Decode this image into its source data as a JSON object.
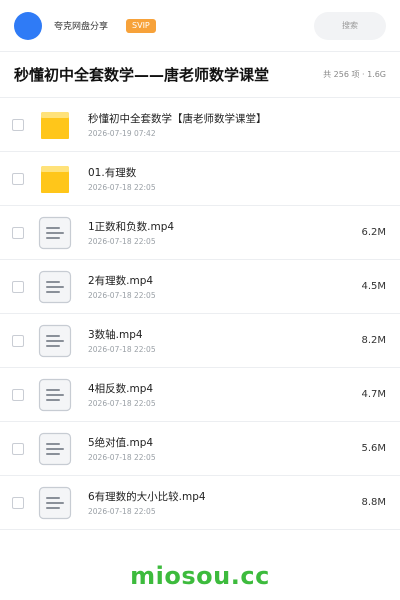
{
  "header": {
    "username": "夸克网盘分享",
    "badge": "SVIP",
    "search_placeholder": "搜索"
  },
  "folder": {
    "title": "秒懂初中全套数学——唐老师数学课堂",
    "meta": "共 256 项 · 1.6G"
  },
  "files": [
    {
      "name": "秒懂初中全套数学【唐老师数学课堂】",
      "date": "2026-07-19 07:42",
      "size": "",
      "icon": "folder-icon"
    },
    {
      "name": "01.有理数",
      "date": "2026-07-18 22:05",
      "size": "",
      "icon": "folder-icon"
    },
    {
      "name": "1正数和负数.mp4",
      "date": "2026-07-18 22:05",
      "size": "6.2M",
      "icon": "file-icon"
    },
    {
      "name": "2有理数.mp4",
      "date": "2026-07-18 22:05",
      "size": "4.5M",
      "icon": "file-icon"
    },
    {
      "name": "3数轴.mp4",
      "date": "2026-07-18 22:05",
      "size": "8.2M",
      "icon": "file-icon"
    },
    {
      "name": "4相反数.mp4",
      "date": "2026-07-18 22:05",
      "size": "4.7M",
      "icon": "file-icon"
    },
    {
      "name": "5绝对值.mp4",
      "date": "2026-07-18 22:05",
      "size": "5.6M",
      "icon": "file-icon"
    },
    {
      "name": "6有理数的大小比较.mp4",
      "date": "2026-07-18 22:05",
      "size": "8.8M",
      "icon": "file-icon"
    }
  ],
  "watermark": "miosou.cc",
  "colors": {
    "avatar": "#2f7bf6",
    "svip_badge": "#f7a23a",
    "folder": "#ffc61a",
    "watermark": "#3dbb3d"
  }
}
